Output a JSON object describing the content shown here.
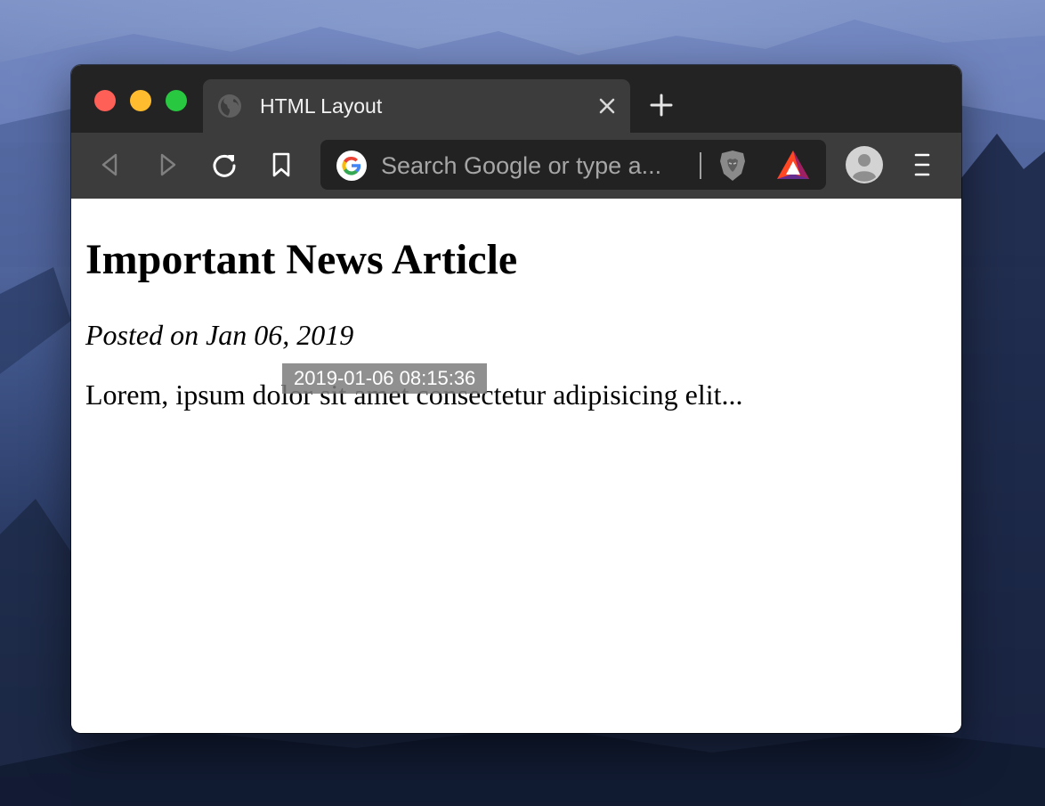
{
  "browser": {
    "tab": {
      "title": "HTML Layout",
      "favicon": "globe-icon"
    },
    "omnibox": {
      "placeholder": "Search Google or type a..."
    },
    "toolbar_icons": [
      "back-arrow-icon",
      "forward-arrow-icon",
      "reload-icon",
      "bookmark-icon",
      "google-icon",
      "brave-shields-icon",
      "bat-rewards-icon",
      "profile-avatar-icon",
      "hamburger-menu-icon"
    ],
    "colors": {
      "tab_bar": "#232323",
      "toolbar": "#3c3c3c",
      "omnibox": "#222222",
      "close": "#fe5f57",
      "minimize": "#febc2e",
      "zoom": "#28c840"
    }
  },
  "page": {
    "heading": "Important News Article",
    "posted": "Posted on Jan 06, 2019",
    "body": "Lorem, ipsum dolor sit amet consectetur adipisicing elit...",
    "tooltip": "2019-01-06 08:15:36"
  }
}
